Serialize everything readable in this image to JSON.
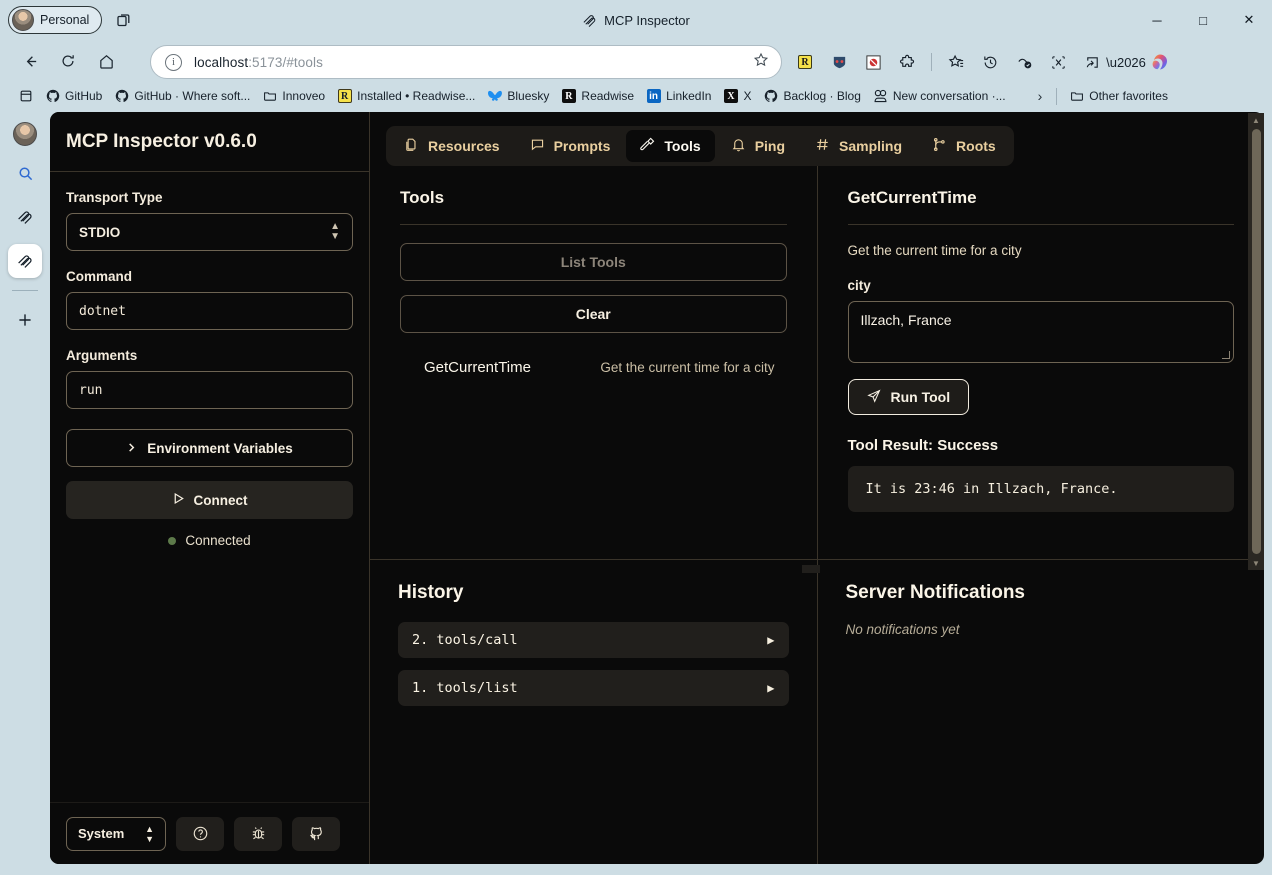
{
  "browser": {
    "profile_label": "Personal",
    "window_title": "MCP Inspector",
    "window_controls": {
      "minimize": "─",
      "maximize": "□",
      "close": "✕"
    },
    "url": {
      "host": "localhost",
      "rest": ":5173/#tools",
      "full": "localhost:5173/#tools"
    },
    "nav": {
      "back": "back-arrow",
      "reload": "reload",
      "home": "home"
    },
    "extensions": [
      "readwise-ext",
      "bitwarden-ext",
      "ublock-ext",
      "puzzle-ext",
      "collections",
      "history",
      "favorites-pen",
      "screenshot",
      "share",
      "more",
      "copilot"
    ],
    "bookmarks": [
      {
        "label": "GitHub",
        "icon": "github-mark"
      },
      {
        "label": "GitHub · Where soft...",
        "icon": "github-mark"
      },
      {
        "label": "Innoveo",
        "icon": "folder"
      },
      {
        "label": "Installed • Readwise...",
        "icon": "readwise-r"
      },
      {
        "label": "Bluesky",
        "icon": "butterfly"
      },
      {
        "label": "Readwise",
        "icon": "readwise-r-dark"
      },
      {
        "label": "LinkedIn",
        "icon": "linkedin-in"
      },
      {
        "label": "X",
        "icon": "x-logo"
      },
      {
        "label": "Backlog · Blog",
        "icon": "github-mark"
      },
      {
        "label": "New conversation ·...",
        "icon": "chatgpt-mark"
      }
    ],
    "bookmarks_overflow": "›",
    "other_favorites": "Other favorites"
  },
  "rail": {
    "items": [
      "avatar",
      "search-icon",
      "copilot-icon",
      "mcp-icon",
      "add-icon"
    ]
  },
  "sidebar": {
    "title": "MCP Inspector v0.6.0",
    "transport_label": "Transport Type",
    "transport_value": "STDIO",
    "command_label": "Command",
    "command_value": "dotnet",
    "arguments_label": "Arguments",
    "arguments_value": "run",
    "env_vars_label": "Environment Variables",
    "connect_label": "Connect",
    "status_label": "Connected",
    "status_color": "#5d7a4a",
    "theme_value": "System",
    "footer_icons": [
      "help-circle-icon",
      "bug-icon",
      "github-icon"
    ]
  },
  "tabs": [
    {
      "label": "Resources",
      "icon": "files-icon",
      "active": false
    },
    {
      "label": "Prompts",
      "icon": "message-square-icon",
      "active": false
    },
    {
      "label": "Tools",
      "icon": "hammer-icon",
      "active": true
    },
    {
      "label": "Ping",
      "icon": "bell-icon",
      "active": false
    },
    {
      "label": "Sampling",
      "icon": "hash-icon",
      "active": false
    },
    {
      "label": "Roots",
      "icon": "git-branch-icon",
      "active": false
    }
  ],
  "tools_pane": {
    "title": "Tools",
    "list_tools_label": "List Tools",
    "clear_label": "Clear",
    "items": [
      {
        "name": "GetCurrentTime",
        "description": "Get the current time for a city"
      }
    ]
  },
  "tool_detail": {
    "title": "GetCurrentTime",
    "description": "Get the current time for a city",
    "arg_label": "city",
    "arg_value": "Illzach, France",
    "run_label": "Run Tool",
    "result_title": "Tool Result: Success",
    "result_text": "It is 23:46 in Illzach, France."
  },
  "history": {
    "title": "History",
    "items": [
      {
        "label": "2. tools/call"
      },
      {
        "label": "1. tools/list"
      }
    ]
  },
  "notifications": {
    "title": "Server Notifications",
    "empty_text": "No notifications yet"
  }
}
